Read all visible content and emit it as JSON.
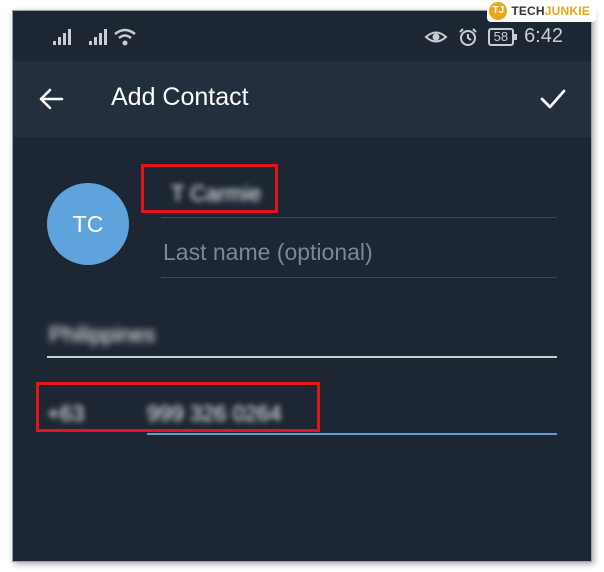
{
  "watermark": {
    "badge": "TJ",
    "tech": "TECH",
    "junkie": "JUNKIE"
  },
  "status": {
    "battery": "58",
    "time": "6:42"
  },
  "appbar": {
    "title": "Add Contact"
  },
  "contact": {
    "initials": "TC",
    "first_name": "T Carmie",
    "last_name_placeholder": "Last name (optional)",
    "country": "Philippines",
    "country_code": "+63",
    "phone": "999 326 0264"
  },
  "colors": {
    "background": "#1d2733",
    "appbar": "#242f3d",
    "avatar": "#5fa4dc",
    "active_underline": "#5aa0e0",
    "highlight": "#e4141b"
  }
}
